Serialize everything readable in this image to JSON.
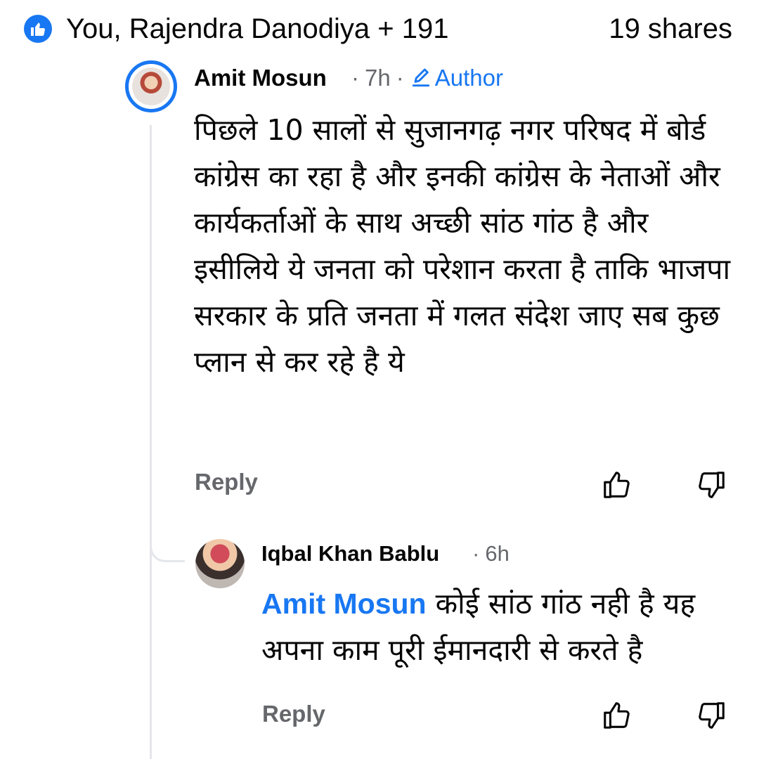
{
  "reactions_bar": {
    "reactors": "You, Rajendra Danodiya + 191",
    "shares": "19 shares",
    "reaction_icon": "thumbs-up-icon",
    "accent": "#1877f2"
  },
  "comments": [
    {
      "author": "Amit Mosun",
      "time": "7h",
      "badge": "Author",
      "badge_icon": "pencil-icon",
      "text": "पिछले 10 सालों से सुजानगढ़ नगर परिषद में बोर्ड कांग्रेस का रहा है और इनकी कांग्रेस के नेताओं और कार्यकर्ताओं के साथ अच्छी सांठ गांठ है और इसीलिये ये जनता को परेशान करता है ताकि भाजपा सरकार के प्रति जनता में गलत संदेश जाए सब कुछ प्लान से कर रहे है ये",
      "reply_label": "Reply"
    },
    {
      "author": "Iqbal Khan Bablu",
      "time": "6h",
      "mention": "Amit Mosun",
      "text": " कोई सांठ गांठ नही है यह अपना काम पूरी ईमानदारी से करते है",
      "reply_label": "Reply"
    }
  ],
  "colors": {
    "link": "#1877f2",
    "secondary_text": "#65676b",
    "thread_line": "#e4e6eb"
  }
}
